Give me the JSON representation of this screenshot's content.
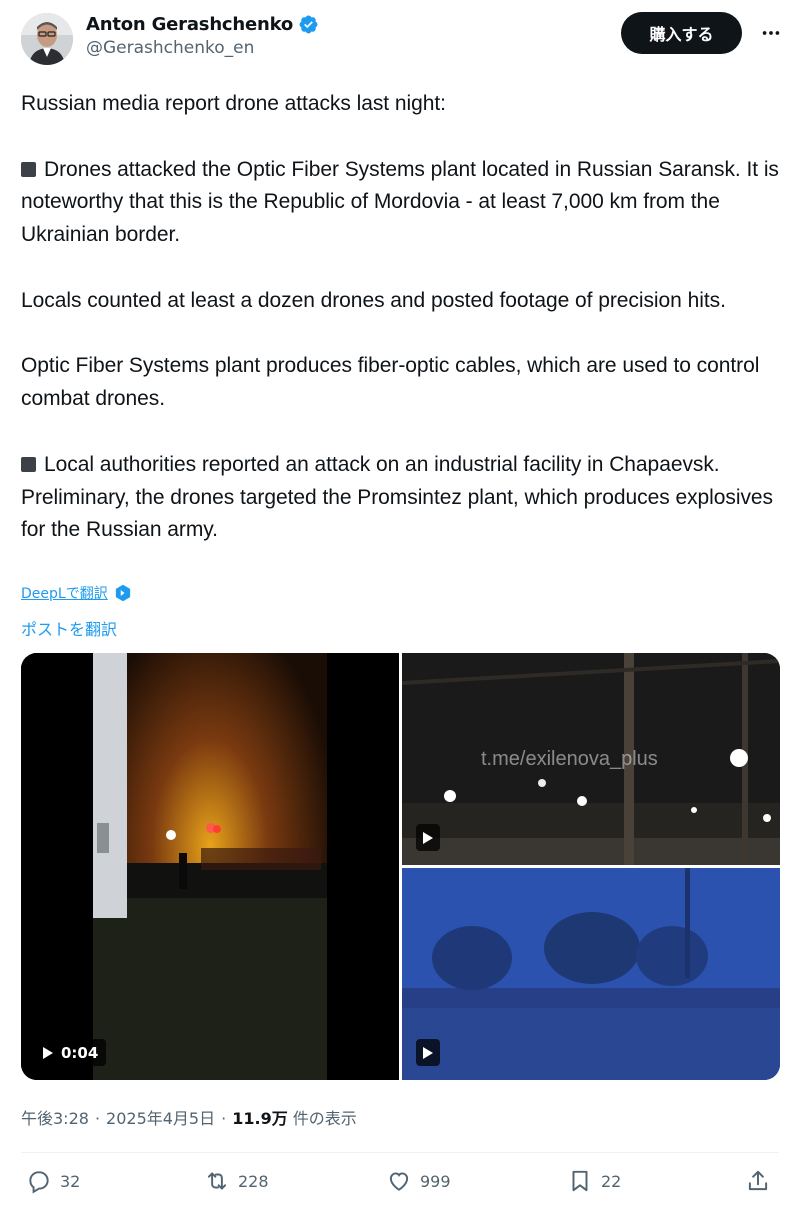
{
  "author": {
    "name": "Anton Gerashchenko",
    "handle": "@Gerashchenko_en"
  },
  "subscribe_label": "購入する",
  "more_label": "…",
  "tweet": {
    "intro": "Russian media report drone attacks last night:",
    "para1": "Drones attacked the Optic Fiber Systems plant located in Russian Saransk. It is noteworthy that this is the Republic of Mordovia - at least 7,000 km from the Ukrainian border.",
    "para2": "Locals counted at least a dozen drones and posted footage of precision hits.",
    "para3": "Optic Fiber Systems plant produces fiber-optic cables, which are used to control combat drones.",
    "para4": "Local authorities reported an attack on an industrial facility in Chapaevsk. Preliminary, the drones targeted the Promsintez plant, which produces explosives for the Russian army."
  },
  "deepl_label": "DeepLで翻訳",
  "translate_label": "ポストを翻訳",
  "media": {
    "video_duration": "0:04",
    "watermark": "t.me/exilenova_plus"
  },
  "meta": {
    "time": "午後3:28",
    "date": "2025年4月5日",
    "views_count": "11.9万",
    "views_label": "件の表示",
    "separator": "·"
  },
  "actions": {
    "replies": "32",
    "reposts": "228",
    "likes": "999",
    "bookmarks": "22"
  },
  "colors": {
    "accent": "#1d9bf0",
    "verified": "#1d9bf0",
    "text": "#0f1419",
    "muted": "#536471"
  }
}
